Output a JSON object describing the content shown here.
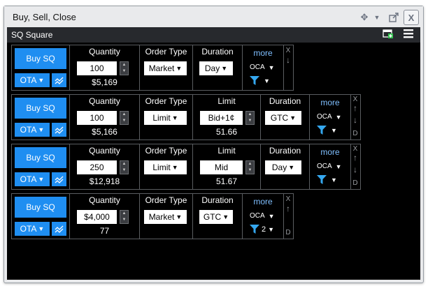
{
  "window": {
    "title": "Buy, Sell, Close"
  },
  "panel": {
    "title": "SQ Square"
  },
  "rows": [
    {
      "buy_label": "Buy SQ",
      "route_label": "OTA",
      "quantity_label": "Quantity",
      "quantity": "100",
      "quantity_value": "$5,169",
      "order_type_label": "Order Type",
      "order_type": "Market",
      "duration_label": "Duration",
      "duration": "Day",
      "more_label": "more",
      "oca_label": "OCA",
      "side_top": "X",
      "side_mid": "↓",
      "side_bottom": ""
    },
    {
      "buy_label": "Buy SQ",
      "route_label": "OTA",
      "quantity_label": "Quantity",
      "quantity": "100",
      "quantity_value": "$5,166",
      "order_type_label": "Order Type",
      "order_type": "Limit",
      "limit_label": "Limit",
      "limit": "Bid+1¢",
      "limit_value": "51.66",
      "duration_label": "Duration",
      "duration": "GTC",
      "more_label": "more",
      "oca_label": "OCA",
      "side_top": "X",
      "side_up": "↑",
      "side_down": "↓",
      "side_bottom": "D"
    },
    {
      "buy_label": "Buy SQ",
      "route_label": "OTA",
      "quantity_label": "Quantity",
      "quantity": "250",
      "quantity_value": "$12,918",
      "order_type_label": "Order Type",
      "order_type": "Limit",
      "limit_label": "Limit",
      "limit": "Mid",
      "limit_value": "51.67",
      "duration_label": "Duration",
      "duration": "Day",
      "more_label": "more",
      "oca_label": "OCA",
      "side_top": "X",
      "side_up": "↑",
      "side_down": "↓",
      "side_bottom": "D"
    },
    {
      "buy_label": "Buy SQ",
      "route_label": "OTA",
      "quantity_label": "Quantity",
      "quantity": "$4,000",
      "quantity_value": "77",
      "order_type_label": "Order Type",
      "order_type": "Market",
      "duration_label": "Duration",
      "duration": "GTC",
      "more_label": "more",
      "oca_label": "OCA",
      "filter_count": "2",
      "side_top": "X",
      "side_mid": "↑",
      "side_bottom": "D"
    }
  ],
  "colors": {
    "accent": "#1f8ef1",
    "background": "#000000",
    "more_link": "#7fbfff",
    "filter": "#35a8f0"
  },
  "icons": [
    "move-icon",
    "chevron-down-icon",
    "pop-out-icon",
    "close-icon",
    "add-window-icon",
    "menu-icon",
    "chart-icon",
    "filter-icon",
    "spin-up-icon",
    "spin-down-icon"
  ]
}
